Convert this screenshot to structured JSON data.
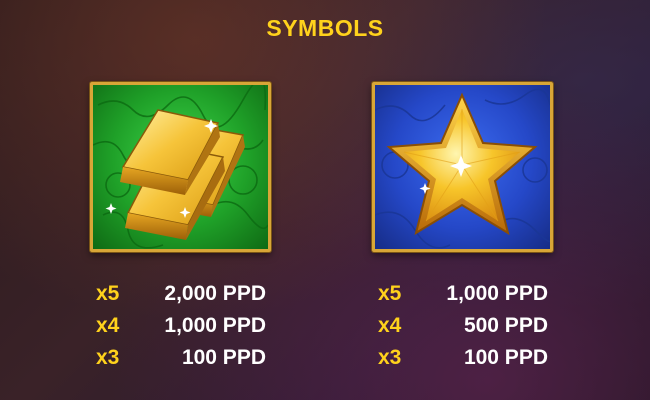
{
  "title": "SYMBOLS",
  "colors": {
    "accent": "#ffd21c",
    "text": "#ffffff",
    "frame": "#d8a637"
  },
  "symbols": [
    {
      "icon": "gold-bars-icon",
      "pays": [
        {
          "mult": "x5",
          "amount": "2,000 PPD"
        },
        {
          "mult": "x4",
          "amount": "1,000 PPD"
        },
        {
          "mult": "x3",
          "amount": "100 PPD"
        }
      ]
    },
    {
      "icon": "star-icon",
      "pays": [
        {
          "mult": "x5",
          "amount": "1,000 PPD"
        },
        {
          "mult": "x4",
          "amount": "500 PPD"
        },
        {
          "mult": "x3",
          "amount": "100 PPD"
        }
      ]
    }
  ]
}
